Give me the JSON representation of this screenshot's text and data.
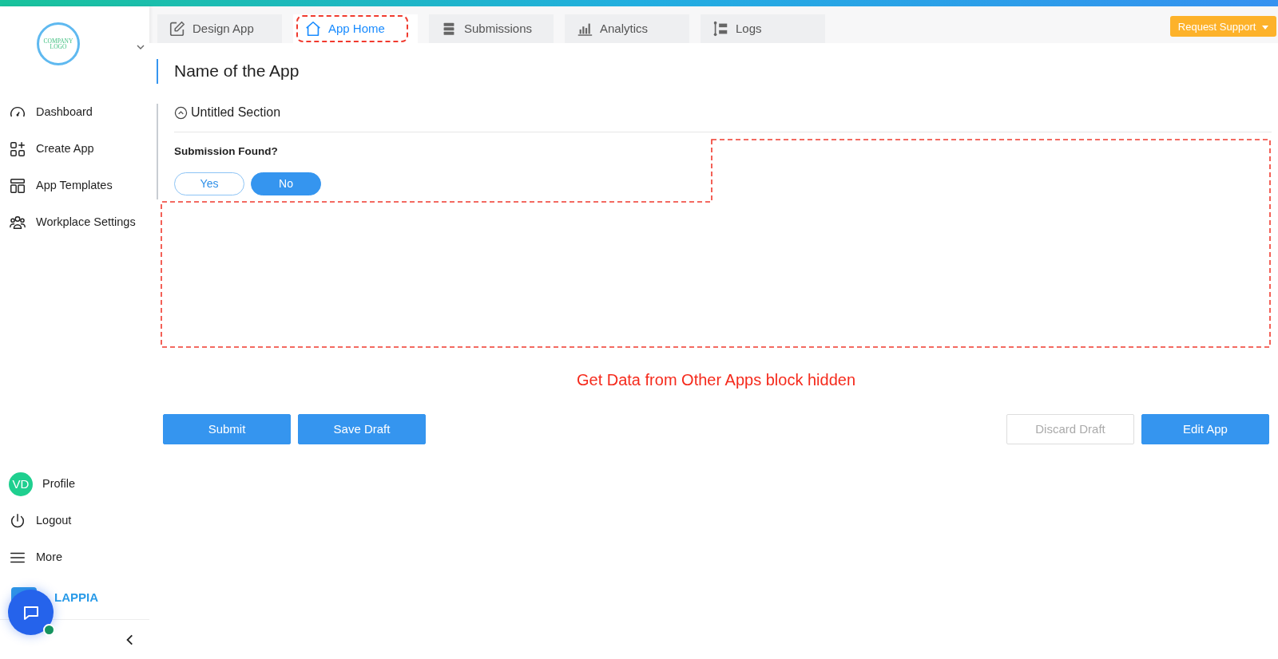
{
  "sidebar": {
    "logo_lines": [
      "COMPANY",
      "LOGO"
    ],
    "nav": [
      {
        "label": "Dashboard"
      },
      {
        "label": "Create App"
      },
      {
        "label": "App Templates"
      },
      {
        "label": "Workplace Settings"
      }
    ],
    "profile": {
      "initials": "VD",
      "label": "Profile"
    },
    "bottom_nav": [
      {
        "label": "Logout"
      },
      {
        "label": "More"
      }
    ],
    "brand": "LAPPIA"
  },
  "tabs": [
    {
      "label": "Design App",
      "selected": false,
      "annotated": false
    },
    {
      "label": "App Home",
      "selected": true,
      "annotated": true
    },
    {
      "label": "Submissions",
      "selected": false,
      "annotated": false
    },
    {
      "label": "Analytics",
      "selected": false,
      "annotated": false
    },
    {
      "label": "Logs",
      "selected": false,
      "annotated": false
    }
  ],
  "request_support": "Request Support",
  "app_title": "Name of the App",
  "section": {
    "title": "Untitled Section",
    "expanded": true,
    "question": "Submission Found?",
    "options": [
      {
        "label": "Yes",
        "selected": false
      },
      {
        "label": "No",
        "selected": true
      }
    ]
  },
  "annotation": "Get Data from Other Apps block hidden",
  "actions_left": [
    "Submit",
    "Save Draft"
  ],
  "actions_right": [
    {
      "label": "Discard Draft",
      "disabled": true
    },
    {
      "label": "Edit App",
      "disabled": false
    }
  ]
}
